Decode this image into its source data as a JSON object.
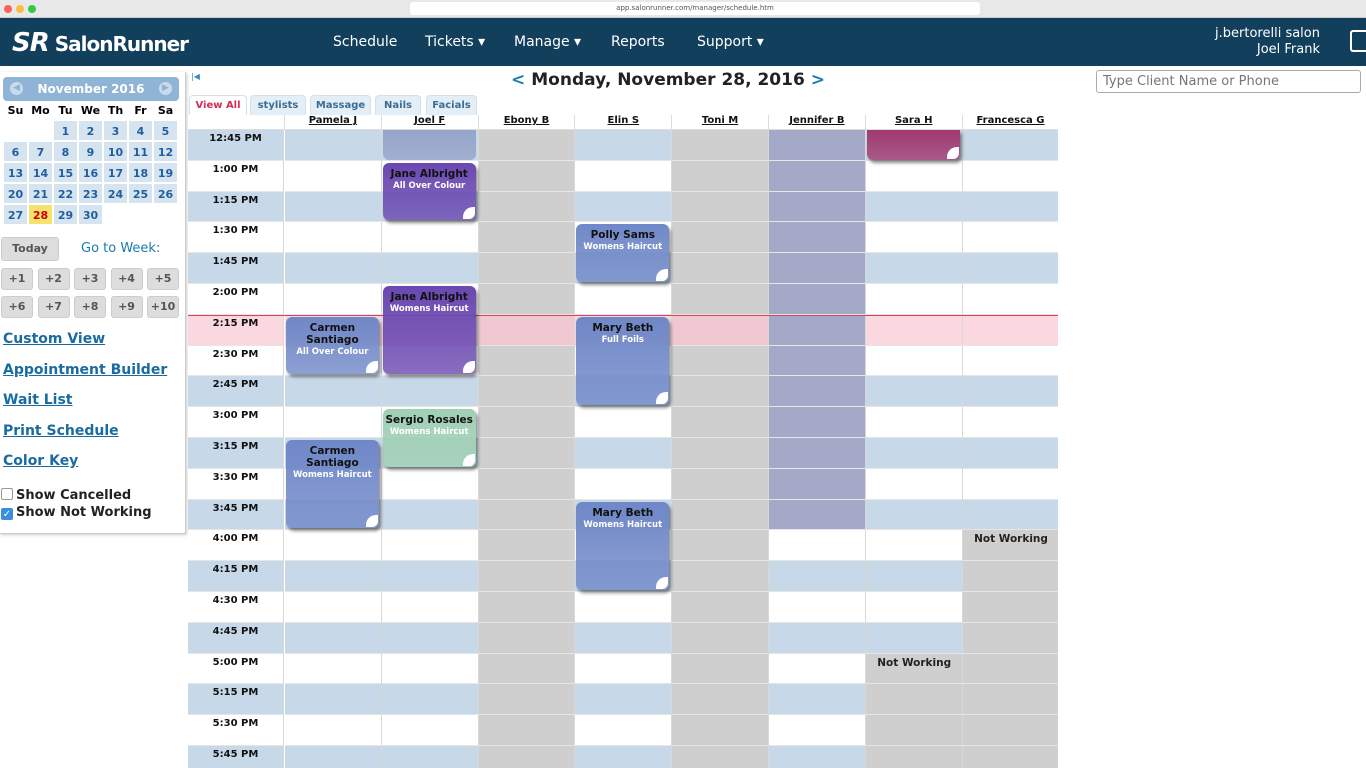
{
  "browser": {
    "url": "app.salonrunner.com/manager/schedule.htm"
  },
  "nav": {
    "logo": "SalonRunner",
    "items": [
      "Schedule",
      "Tickets ▾",
      "Manage ▾",
      "Reports",
      "Support ▾"
    ],
    "salon": "j.bertorelli salon",
    "user": "Joel Frank"
  },
  "calendar": {
    "month": "November 2016",
    "dow": [
      "Su",
      "Mo",
      "Tu",
      "We",
      "Th",
      "Fr",
      "Sa"
    ],
    "first_weekday": 2,
    "days": 30,
    "selected": 28
  },
  "sidebar": {
    "today": "Today",
    "go_to_week": "Go to Week:",
    "weeks": [
      "+1",
      "+2",
      "+3",
      "+4",
      "+5",
      "+6",
      "+7",
      "+8",
      "+9",
      "+10"
    ],
    "links": [
      "Custom View",
      "Appointment Builder",
      "Wait List",
      "Print Schedule",
      "Color Key"
    ],
    "checks": [
      {
        "label": "Show Cancelled",
        "checked": false
      },
      {
        "label": "Show Not Working",
        "checked": true
      }
    ]
  },
  "header": {
    "date": "Monday, November 28, 2016",
    "prev": "<",
    "next": ">"
  },
  "search": {
    "placeholder": "Type Client Name or Phone"
  },
  "tabs": [
    {
      "label": "View All",
      "active": true
    },
    {
      "label": "stylists"
    },
    {
      "label": "Massage"
    },
    {
      "label": "Nails"
    },
    {
      "label": "Facials"
    }
  ],
  "stylists": [
    "Pamela J",
    "Joel F",
    "Ebony B",
    "Elin S",
    "Toni M",
    "Jennifer B",
    "Sara H",
    "Francesca G"
  ],
  "times": [
    "12:45 PM",
    "1:00 PM",
    "1:15 PM",
    "1:30 PM",
    "1:45 PM",
    "2:00 PM",
    "2:15 PM",
    "2:30 PM",
    "2:45 PM",
    "3:00 PM",
    "3:15 PM",
    "3:30 PM",
    "3:45 PM",
    "4:00 PM",
    "4:15 PM",
    "4:30 PM",
    "4:45 PM",
    "5:00 PM",
    "5:15 PM",
    "5:30 PM",
    "5:45 PM"
  ],
  "current_time_slot": "2:15 PM",
  "not_working_label": "Not Working",
  "unavailable": [
    {
      "stylist": "Ebony B",
      "from": "12:45 PM",
      "to": "end",
      "type": "grey"
    },
    {
      "stylist": "Toni M",
      "from": "12:45 PM",
      "to": "end",
      "type": "grey"
    },
    {
      "stylist": "Jennifer B",
      "from": "12:45 PM",
      "to": "4:00 PM",
      "type": "blocked"
    },
    {
      "stylist": "Sara H",
      "from": "5:00 PM",
      "to": "end",
      "type": "grey",
      "label": "Not Working"
    },
    {
      "stylist": "Francesca G",
      "from": "4:00 PM",
      "to": "end",
      "type": "grey",
      "label": "Not Working"
    }
  ],
  "appointments": [
    {
      "stylist": "Joel F",
      "client": "",
      "service": "",
      "start": "12:45 PM",
      "end": "1:00 PM",
      "color": "#8c9cc4",
      "faded": true
    },
    {
      "stylist": "Sara H",
      "client": "",
      "service": "",
      "start": "12:45 PM",
      "end": "1:00 PM",
      "color": "#a03a70"
    },
    {
      "stylist": "Joel F",
      "client": "Jane Albright",
      "service": "All Over Colour",
      "start": "1:00 PM",
      "end": "1:30 PM",
      "color": "#6a48b0"
    },
    {
      "stylist": "Elin S",
      "client": "Polly Sams",
      "service": "Womens Haircut",
      "start": "1:30 PM",
      "end": "2:00 PM",
      "color": "#7088c8"
    },
    {
      "stylist": "Joel F",
      "client": "Jane Albright",
      "service": "Womens Haircut",
      "start": "2:00 PM",
      "end": "2:45 PM",
      "color": "#6a48b0"
    },
    {
      "stylist": "Pamela J",
      "client": "Carmen Santiago",
      "service": "All Over Colour",
      "start": "2:15 PM",
      "end": "2:45 PM",
      "color": "#7088c8"
    },
    {
      "stylist": "Elin S",
      "client": "Mary Beth",
      "service": "Full Foils",
      "start": "2:15 PM",
      "end": "3:00 PM",
      "color": "#7088c8"
    },
    {
      "stylist": "Joel F",
      "client": "Sergio Rosales",
      "service": "Womens Haircut",
      "start": "3:00 PM",
      "end": "3:30 PM",
      "color": "#9fcfb4"
    },
    {
      "stylist": "Pamela J",
      "client": "Carmen Santiago",
      "service": "Womens Haircut",
      "start": "3:15 PM",
      "end": "4:00 PM",
      "color": "#7088c8"
    },
    {
      "stylist": "Elin S",
      "client": "Mary Beth",
      "service": "Womens Haircut",
      "start": "3:45 PM",
      "end": "4:30 PM",
      "color": "#7088c8"
    }
  ]
}
